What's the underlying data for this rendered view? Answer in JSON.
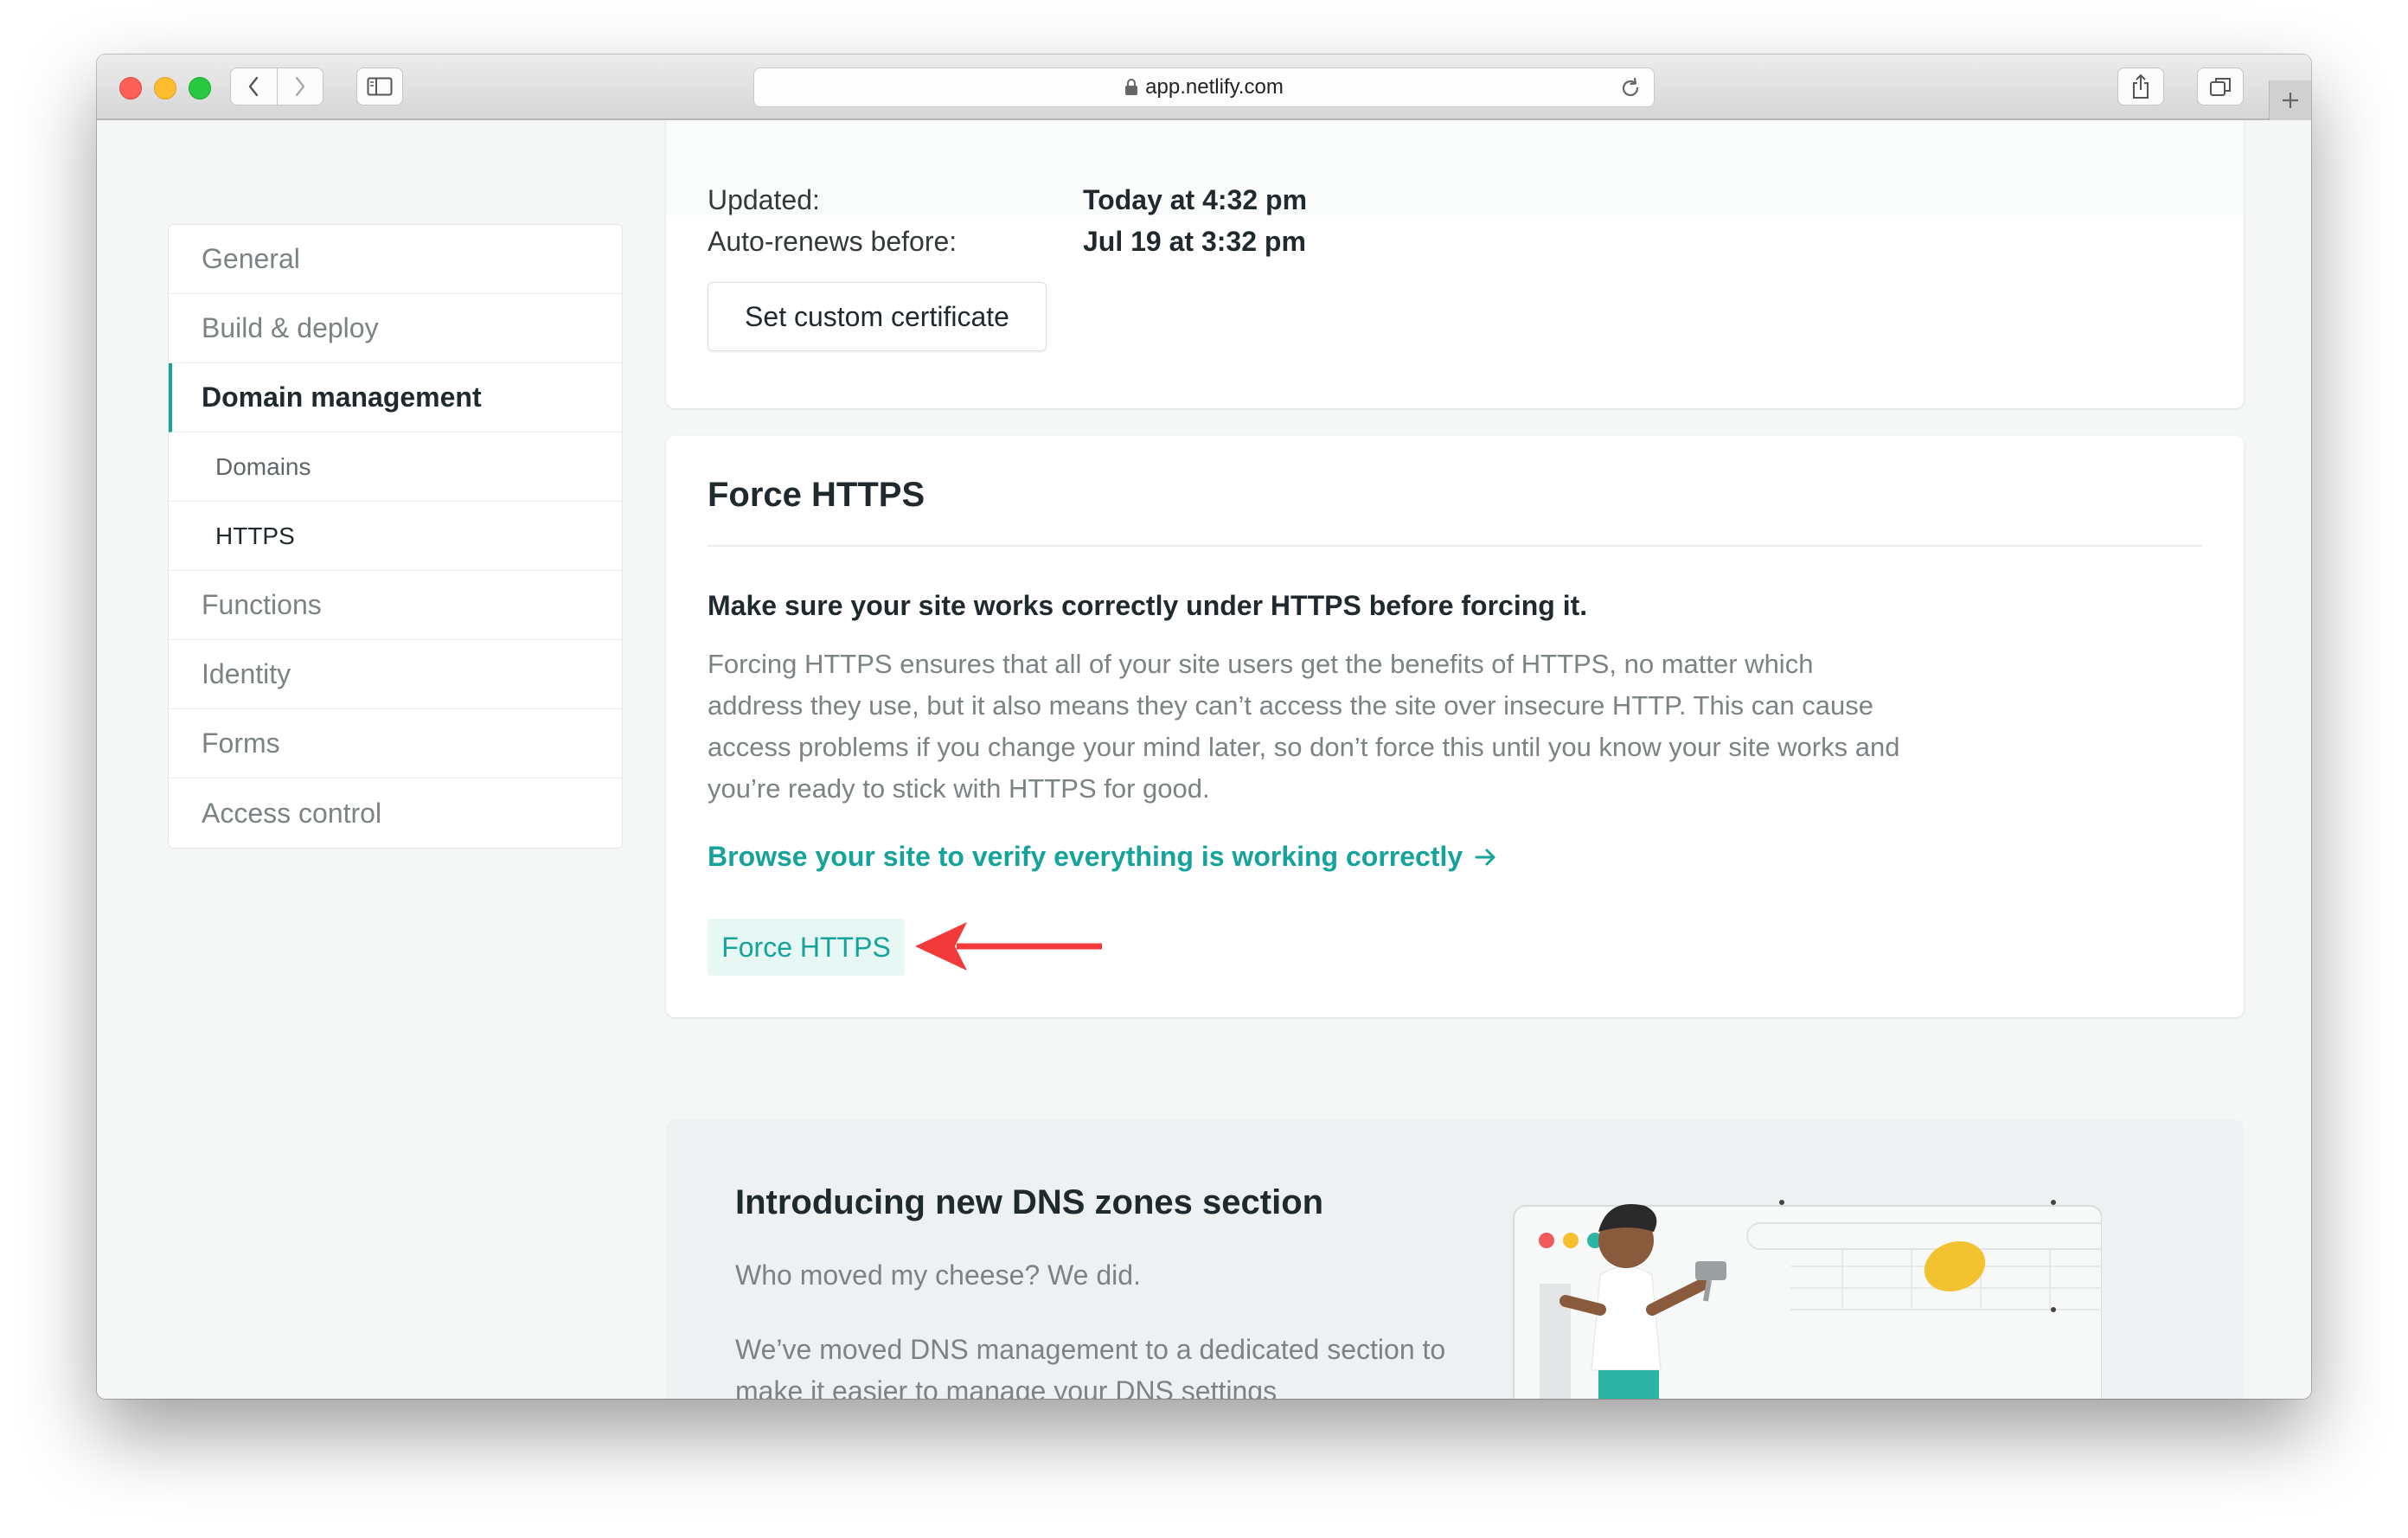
{
  "browser": {
    "url": "app.netlify.com"
  },
  "sidebar": {
    "items": [
      {
        "label": "General"
      },
      {
        "label": "Build & deploy"
      },
      {
        "label": "Domain management"
      },
      {
        "label": "Domains"
      },
      {
        "label": "HTTPS"
      },
      {
        "label": "Functions"
      },
      {
        "label": "Identity"
      },
      {
        "label": "Forms"
      },
      {
        "label": "Access control"
      }
    ]
  },
  "certificate": {
    "updated_label": "Updated:",
    "updated_value": "Today at 4:32 pm",
    "renews_label": "Auto-renews before:",
    "renews_value": "Jul 19 at 3:32 pm",
    "custom_button": "Set custom certificate"
  },
  "force_https": {
    "title": "Force HTTPS",
    "warning": "Make sure your site works correctly under HTTPS before forcing it.",
    "description": "Forcing HTTPS ensures that all of your site users get the benefits of HTTPS, no matter which address they use, but it also means they can’t access the site over insecure HTTP. This can cause access problems if you change your mind later, so don’t force this until you know your site works and you’re ready to stick with HTTPS for good.",
    "browse_link": "Browse your site to verify everything is working correctly",
    "button": "Force HTTPS"
  },
  "dns_promo": {
    "title": "Introducing new DNS zones section",
    "paragraph1": "Who moved my cheese? We did.",
    "paragraph2": "We’ve moved DNS management to a dedicated section to make it easier to manage your DNS settings"
  },
  "colors": {
    "accent": "#15a39c",
    "annotation_arrow": "#f23a3a"
  }
}
